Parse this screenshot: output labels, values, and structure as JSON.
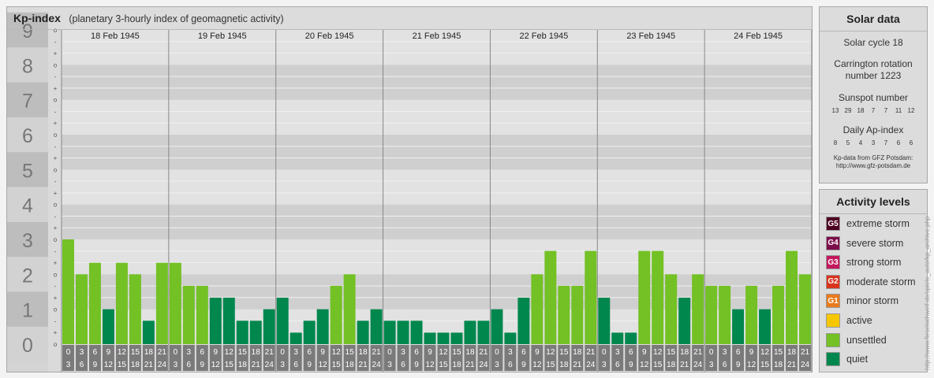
{
  "title": "Kp-index",
  "subtitle": "(planetary 3-hourly index of geomagnetic activity)",
  "chart_data": {
    "type": "bar",
    "title": "Kp-index",
    "ylim": [
      0,
      9
    ],
    "ytick_labels": [
      "0",
      "1",
      "2",
      "3",
      "4",
      "5",
      "6",
      "7",
      "8",
      "9"
    ],
    "minor_tick_labels": [
      "o",
      "+",
      "-"
    ],
    "days": [
      "18 Feb 1945",
      "19 Feb 1945",
      "20 Feb 1945",
      "21 Feb 1945",
      "22 Feb 1945",
      "23 Feb 1945",
      "24 Feb 1945"
    ],
    "interval_start_labels": [
      "0",
      "3",
      "6",
      "9",
      "12",
      "15",
      "18",
      "21"
    ],
    "interval_end_labels": [
      "3",
      "6",
      "9",
      "12",
      "15",
      "18",
      "21",
      "24"
    ],
    "values": [
      [
        3.0,
        2.0,
        2.33,
        1.0,
        2.33,
        2.0,
        0.67,
        2.33
      ],
      [
        2.33,
        1.67,
        1.67,
        1.33,
        1.33,
        0.67,
        0.67,
        1.0
      ],
      [
        1.33,
        0.33,
        0.67,
        1.0,
        1.67,
        2.0,
        0.67,
        1.0
      ],
      [
        0.67,
        0.67,
        0.67,
        0.33,
        0.33,
        0.33,
        0.67,
        0.67
      ],
      [
        1.0,
        0.33,
        1.33,
        2.0,
        2.67,
        1.67,
        1.67,
        2.67
      ],
      [
        1.33,
        0.33,
        0.33,
        2.67,
        2.67,
        2.0,
        1.33,
        2.0
      ],
      [
        1.67,
        1.67,
        1.0,
        1.67,
        1.0,
        1.67,
        2.67,
        2.0
      ]
    ],
    "colors": {
      "quiet": "#00874d",
      "unsettled": "#73c125"
    }
  },
  "solar": {
    "title": "Solar data",
    "cycle": "Solar cycle 18",
    "carrington_line1": "Carrington rotation",
    "carrington_line2": "number 1223",
    "sunspot_label": "Sunspot number",
    "sunspot_values": [
      "13",
      "29",
      "18",
      "7",
      "7",
      "11",
      "12"
    ],
    "ap_label": "Daily Ap-index",
    "ap_values": [
      "8",
      "5",
      "4",
      "3",
      "7",
      "6",
      "6"
    ],
    "credit_line1": "Kp-data from GFZ Potsdam:",
    "credit_line2": "http://www.gfz-potsdam.de"
  },
  "activity": {
    "title": "Activity levels",
    "levels": [
      {
        "code": "G5",
        "label": "extreme storm",
        "color": "#4d0021"
      },
      {
        "code": "G4",
        "label": "severe storm",
        "color": "#7d0c4a"
      },
      {
        "code": "G3",
        "label": "strong storm",
        "color": "#c3185e"
      },
      {
        "code": "G2",
        "label": "moderate storm",
        "color": "#d9331d"
      },
      {
        "code": "G1",
        "label": "minor storm",
        "color": "#e97b1c"
      },
      {
        "code": "",
        "label": "active",
        "color": "#f6c700"
      },
      {
        "code": "",
        "label": "unsettled",
        "color": "#73c125"
      },
      {
        "code": "",
        "label": "quiet",
        "color": "#00874d"
      }
    ]
  },
  "side_url": "http://www.fieselschweif.de/spiele_auto/kp_archive.php"
}
